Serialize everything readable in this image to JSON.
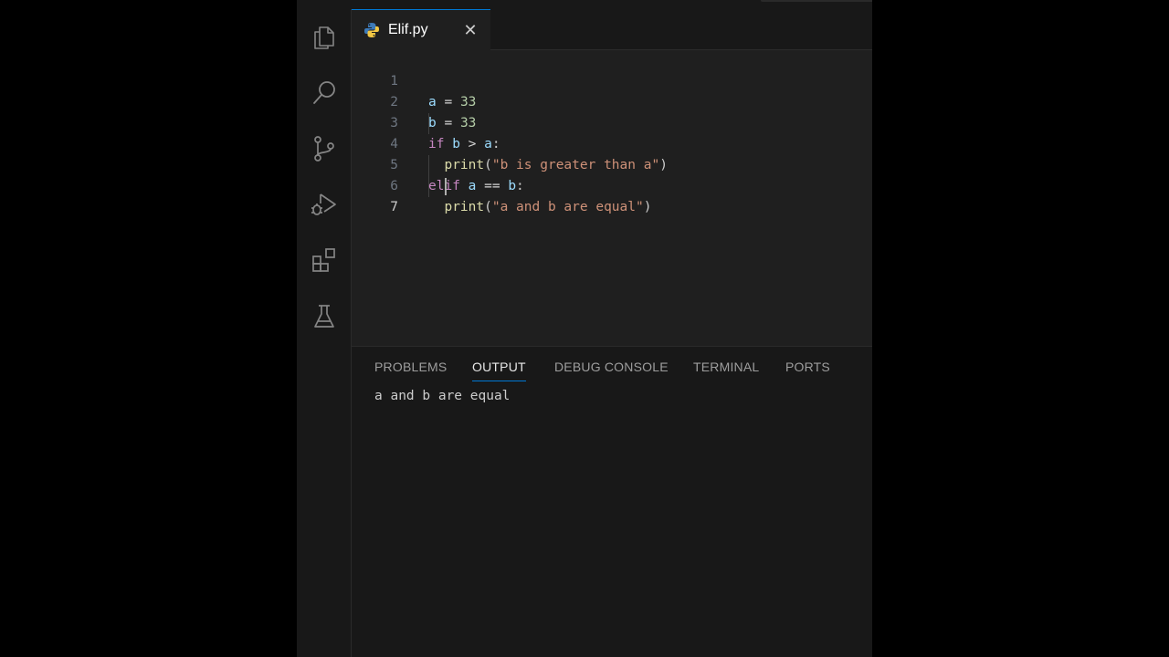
{
  "editor_tab": {
    "filename": "Elif.py",
    "icon": "python-file-icon",
    "close_glyph": "✕"
  },
  "activity_bar": [
    {
      "name": "explorer-icon"
    },
    {
      "name": "search-icon"
    },
    {
      "name": "source-control-icon"
    },
    {
      "name": "run-debug-icon"
    },
    {
      "name": "extensions-icon"
    },
    {
      "name": "testing-icon"
    }
  ],
  "code_lines": [
    {
      "number": "1",
      "text": "a = 33"
    },
    {
      "number": "2",
      "text": "b = 33"
    },
    {
      "number": "3",
      "text": "if b > a:"
    },
    {
      "number": "4",
      "text": "  print(\"b is greater than a\")"
    },
    {
      "number": "5",
      "text": "elif a == b:"
    },
    {
      "number": "6",
      "text": "  print(\"a and b are equal\")"
    },
    {
      "number": "7",
      "text": "  "
    }
  ],
  "panel": {
    "tabs": [
      "PROBLEMS",
      "OUTPUT",
      "DEBUG CONSOLE",
      "TERMINAL",
      "PORTS"
    ],
    "active_tab": "OUTPUT",
    "output": "a and b are equal"
  },
  "colors": {
    "accent": "#0078d4",
    "keyword": "#c586c0",
    "variable": "#9cdcfe",
    "number": "#b5cea8",
    "function": "#dcdcaa",
    "string": "#ce9178"
  }
}
